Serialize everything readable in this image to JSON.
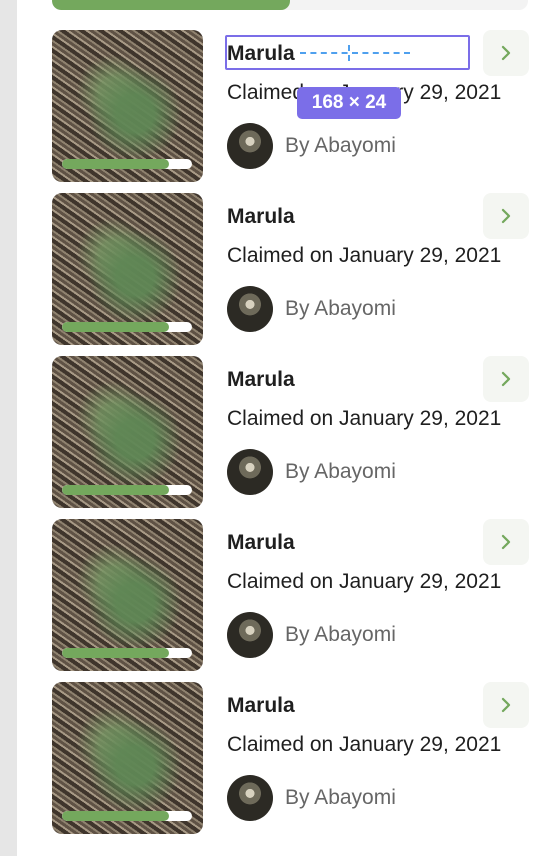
{
  "top_progress": {
    "fraction": 0.5
  },
  "items": [
    {
      "title": "Marula",
      "claimed": "Claimed on January 29, 2021",
      "by": "By Abayomi",
      "progress": 0.82
    },
    {
      "title": "Marula",
      "claimed": "Claimed on January 29, 2021",
      "by": "By Abayomi",
      "progress": 0.82
    },
    {
      "title": "Marula",
      "claimed": "Claimed on January 29, 2021",
      "by": "By Abayomi",
      "progress": 0.82
    },
    {
      "title": "Marula",
      "claimed": "Claimed on January 29, 2021",
      "by": "By Abayomi",
      "progress": 0.82
    },
    {
      "title": "Marula",
      "claimed": "Claimed on January 29, 2021",
      "by": "By Abayomi",
      "progress": 0.82
    }
  ],
  "overlay": {
    "size_label": "168 × 24"
  },
  "colors": {
    "accent": "#74a85d",
    "selection": "#7b6ee8",
    "measure": "#4fa0ee"
  },
  "icons": {
    "row_action": "chevron-right-icon"
  }
}
